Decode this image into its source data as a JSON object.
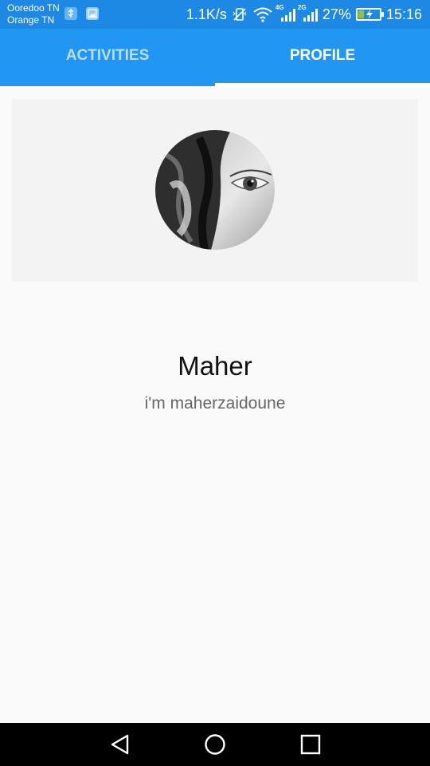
{
  "status_bar": {
    "carrier_1": "Ooredoo TN",
    "carrier_2": "Orange TN",
    "net_speed": "1.1K/s",
    "sim1_network": "4G",
    "sim2_network": "2G",
    "battery_percent": "27%",
    "battery_level": 0.27,
    "time": "15:16",
    "icons": [
      "usb-notification-icon",
      "image-notification-icon",
      "vibrate-off-icon",
      "wifi-icon",
      "signal-icon",
      "signal-icon",
      "battery-charging-icon"
    ]
  },
  "tabs": [
    {
      "label": "ACTIVITIES",
      "active": false
    },
    {
      "label": "PROFILE",
      "active": true
    }
  ],
  "profile": {
    "name": "Maher",
    "bio": "i'm maherzaidoune"
  },
  "nav_bar": {
    "icons": [
      "back-icon",
      "home-icon",
      "recents-icon"
    ]
  },
  "colors": {
    "status_bar": "#1e88e5",
    "tab_bar": "#2196f3",
    "tab_indicator": "#ffffff",
    "background": "#fafafa",
    "header_card": "#f3f3f3"
  }
}
